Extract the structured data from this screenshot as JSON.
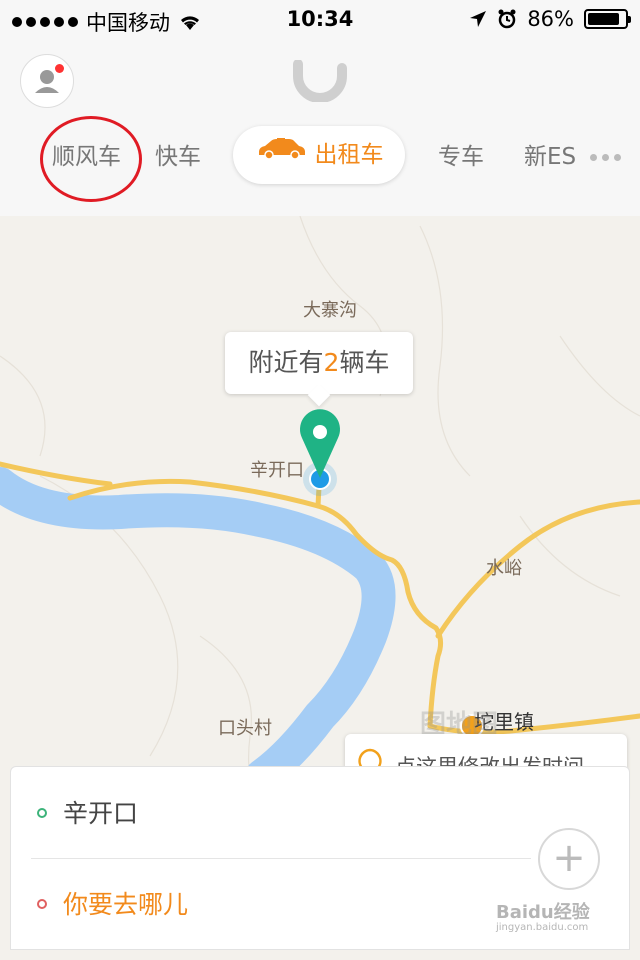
{
  "status_bar": {
    "carrier": "中国移动",
    "time": "10:34",
    "battery": "86%",
    "battery_level": 0.86
  },
  "header": {
    "tabs": [
      {
        "label": "顺风车"
      },
      {
        "label": "快车"
      },
      {
        "label": "出租车",
        "active": true
      },
      {
        "label": "专车"
      },
      {
        "label": "新ES"
      }
    ]
  },
  "map": {
    "places": [
      "大寨沟",
      "辛开口",
      "水峪",
      "口头村",
      "坨里镇"
    ],
    "callout": {
      "prefix": "附近有",
      "count": "2",
      "suffix": "辆车"
    },
    "watermark": "图地图"
  },
  "tip": {
    "text": "点这里修改出发时间"
  },
  "panel": {
    "start": "辛开口",
    "destination": "你要去哪儿"
  },
  "watermark": {
    "text": "Baidu经验",
    "sub": "jingyan.baidu.com"
  },
  "colors": {
    "accent": "#f28a1c",
    "pin": "#1fb385",
    "river": "#a5cdf5",
    "road": "#f3c75a"
  },
  "icons": [
    "signal-dots-icon",
    "wifi-icon",
    "location-arrow-icon",
    "alarm-icon",
    "battery-icon",
    "user-icon",
    "didi-logo-icon",
    "taxi-icon",
    "more-icon",
    "map-pin-icon",
    "bulb-icon",
    "plus-icon"
  ]
}
